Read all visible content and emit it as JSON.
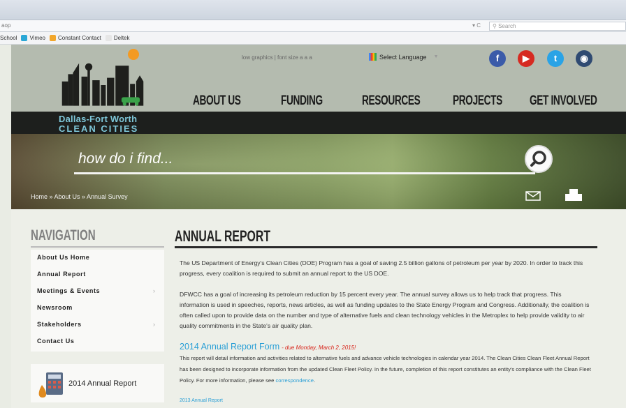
{
  "browser": {
    "url_fragment": "aop",
    "reload": "▾ C",
    "search_placeholder": "Search"
  },
  "bookmarks": [
    {
      "label": "School",
      "color": "#f2a72c"
    },
    {
      "label": "Vimeo",
      "color": "#2aa7d6"
    },
    {
      "label": "Constant Contact",
      "color": "#f2a72c"
    },
    {
      "label": "Deltek",
      "color": "#e6e6e6"
    }
  ],
  "header": {
    "logo_line1": "Dallas-Fort Worth",
    "logo_line2": "CLEAN CITIES",
    "util_links": "low graphics  |  font size a  a  a",
    "language": "Select Language",
    "language_arrow": "▼"
  },
  "social": [
    {
      "icon": "facebook-icon",
      "glyph": "f",
      "color": "#3b5ba9"
    },
    {
      "icon": "youtube-icon",
      "glyph": "▶",
      "color": "#d62a21"
    },
    {
      "icon": "twitter-icon",
      "glyph": "t",
      "color": "#2aa3e6"
    },
    {
      "icon": "instagram-icon",
      "glyph": "◉",
      "color": "#2f4a72"
    }
  ],
  "main_nav": [
    "ABOUT US",
    "FUNDING",
    "RESOURCES",
    "PROJECTS",
    "GET INVOLVED"
  ],
  "hero": {
    "search_prompt": "how do i find...",
    "breadcrumb": "Home  »  About Us  »  Annual Survey"
  },
  "sidebar": {
    "title": "NAVIGATION",
    "items": [
      {
        "label": "About Us Home",
        "has_children": false
      },
      {
        "label": "Annual Report",
        "has_children": false
      },
      {
        "label": "Meetings & Events",
        "has_children": true
      },
      {
        "label": "Newsroom",
        "has_children": false
      },
      {
        "label": "Stakeholders",
        "has_children": true
      },
      {
        "label": "Contact Us",
        "has_children": false
      }
    ],
    "arrow": "›",
    "promo_label": "2014 Annual Report"
  },
  "main": {
    "title": "ANNUAL REPORT",
    "para1": "The US Department of Energy's Clean Cities (DOE) Program has a goal of saving 2.5 billion gallons of petroleum per year by 2020.  In order to track this progress, every coalition is required to submit an annual report to the US DOE.",
    "para2": "DFWCC has a goal of increasing its petroleum reduction by 15 percent every year.  The annual survey allows us to help track that progress.  This information is used in speeches, reports, news articles, as well as funding updates to the State Energy Program and Congress. Additionally, the coalition is often called upon to provide data on the number and type of alternative fuels and clean technology vehicles in the Metroplex to help provide validity to air quality commitments in the State's air quality plan.",
    "form_heading": "2014 Annual Report Form",
    "form_due": "- due Monday, March 2, 2015!",
    "para3": "This report will detail information and activities related to alternative fuels and advance vehicle technologies in calendar year 2014. The Clean Cities Clean Fleet Annual Report has been designed to incorporate information from the updated Clean Fleet Policy. In the future, completion of this report constitutes an entity's compliance with the Clean Fleet Policy. For more information, please see",
    "para3_link": "correspondence",
    "para3_end": ".",
    "small_link": "2013 Annual Report"
  }
}
